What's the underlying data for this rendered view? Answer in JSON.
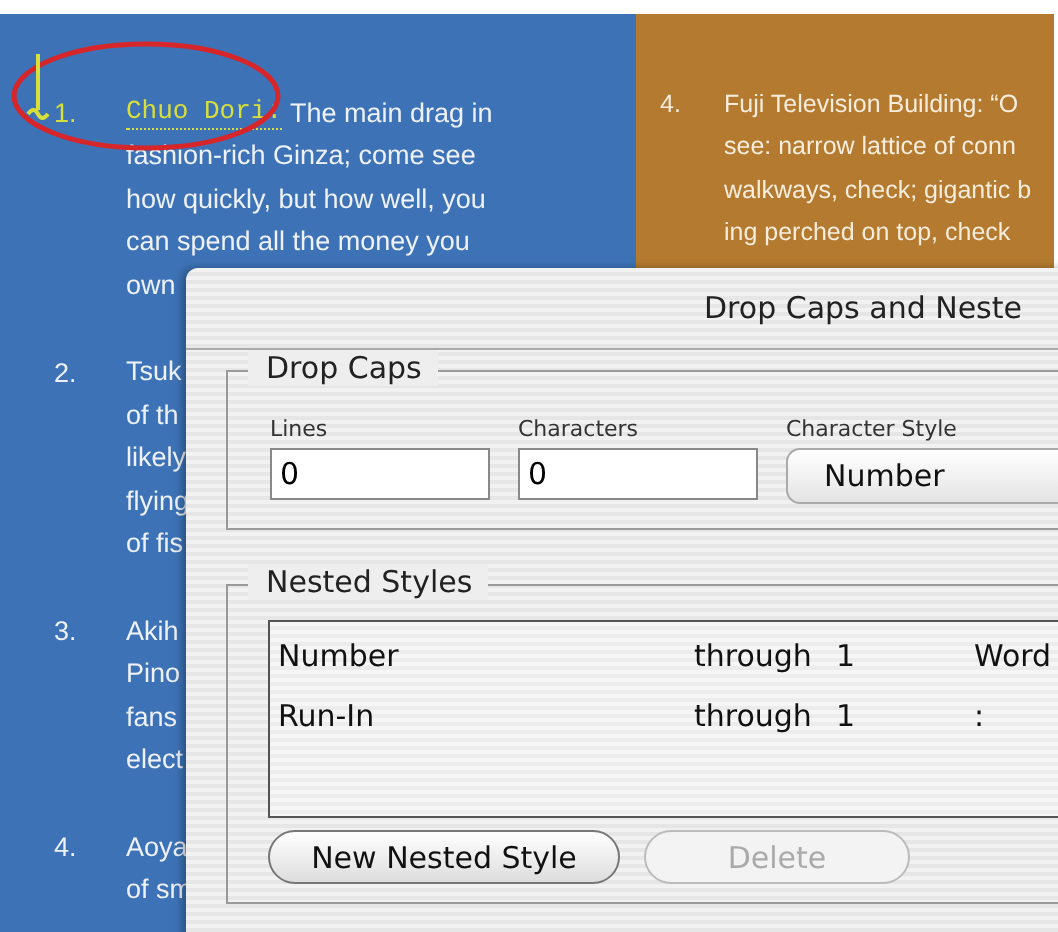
{
  "document": {
    "left_column": [
      {
        "number": "1.",
        "lead": "Chuo Dori:",
        "lines": [
          "The main drag in",
          "fashion-rich Ginza; come see",
          "how quickly, but how well, you",
          "can spend all the money you",
          "own"
        ]
      },
      {
        "number": "2.",
        "lines": [
          "Tsuk",
          "of th",
          "likely",
          "flying",
          "of fis"
        ]
      },
      {
        "number": "3.",
        "lines": [
          "Akih",
          "Pino",
          "fans",
          "elect"
        ]
      },
      {
        "number": "4.",
        "lines": [
          "Aoya",
          "of sm"
        ]
      }
    ],
    "right_column": {
      "number": "4.",
      "lines": [
        "Fuji Television Building: “O",
        "see: narrow lattice of conn",
        "walkways, check; gigantic b",
        "ing perched on top, check"
      ]
    }
  },
  "dialog": {
    "title": "Drop Caps and Neste",
    "drop_caps": {
      "legend": "Drop Caps",
      "lines_label": "Lines",
      "lines_value": "0",
      "characters_label": "Characters",
      "characters_value": "0",
      "style_label": "Character Style",
      "style_value": "Number"
    },
    "nested_styles": {
      "legend": "Nested Styles",
      "rows": [
        {
          "style": "Number",
          "mode": "through",
          "count": "1",
          "unit": "Word"
        },
        {
          "style": "Run-In",
          "mode": "through",
          "count": "1",
          "unit": ":"
        }
      ],
      "buttons": [
        {
          "label": "New Nested Style",
          "disabled": false
        },
        {
          "label": "Delete",
          "disabled": true
        }
      ]
    }
  }
}
